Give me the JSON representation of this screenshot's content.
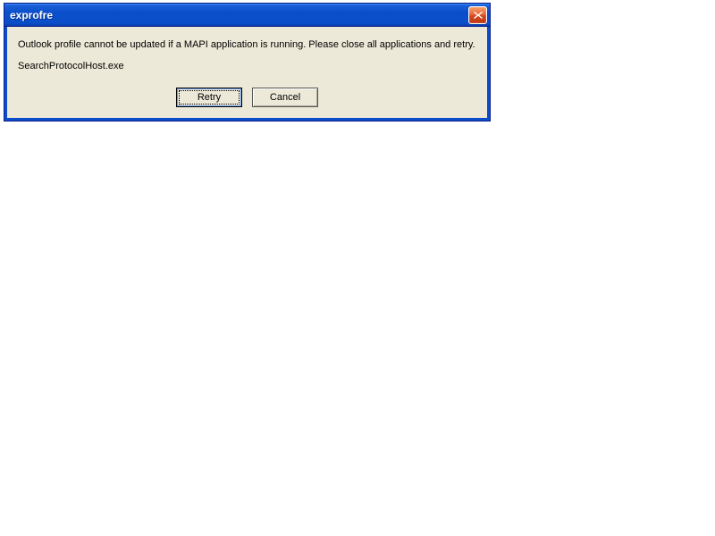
{
  "dialog": {
    "title": "exprofre",
    "message_line1": "Outlook profile cannot be updated if a MAPI application is running. Please close all applications and retry.",
    "message_line2": "SearchProtocolHost.exe",
    "buttons": {
      "retry": "Retry",
      "cancel": "Cancel"
    }
  }
}
